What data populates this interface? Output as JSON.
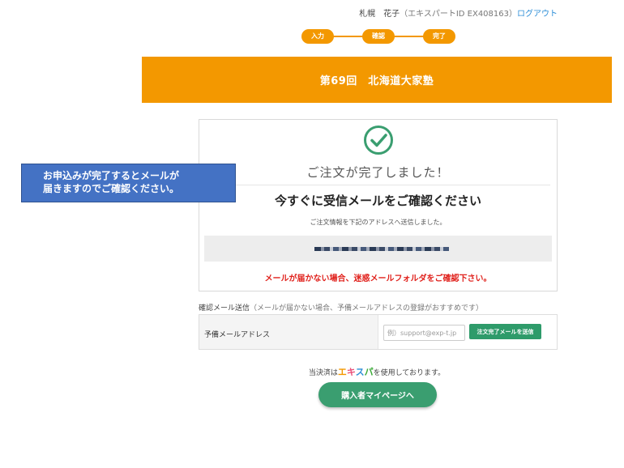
{
  "header": {
    "user_name": "札幌　花子",
    "expert_id": "（エキスパートID EX408163）",
    "logout_label": "ログアウト"
  },
  "steps": [
    {
      "label": "入力"
    },
    {
      "label": "確認"
    },
    {
      "label": "完了"
    }
  ],
  "banner": {
    "title": "第69回　北海道大家塾"
  },
  "completion": {
    "title": "ご注文が完了しました！",
    "mail_check_title": "今すぐに受信メールをご確認ください",
    "sent_text": "ご注文情報を下記のアドレスへ送信しました。",
    "warning_text": "メールが届かない場合、迷惑メールフォルダをご確認下さい。"
  },
  "callout": {
    "line1": "お申込みが完了するとメールが",
    "line2": "届きますのでご確認ください。"
  },
  "confirm_mail": {
    "section_label": "確認メール送信",
    "section_note": "（メールが届かない場合、予備メールアドレスの登録がおすすめです）",
    "row_label": "予備メールアドレス",
    "input_placeholder": "例）support@exp-t.jp",
    "send_button_label": "注文完了メールを送信"
  },
  "payment": {
    "prefix": "当決済は",
    "brand": [
      "エ",
      "キ",
      "ス",
      "パ"
    ],
    "suffix": "を使用しております。"
  },
  "mypage_button_label": "購入者マイページへ",
  "colors": {
    "accent": "#f39800",
    "success": "#3a9e70",
    "warning": "#e0201b",
    "callout": "#4472c4",
    "link": "#2f8fd8"
  }
}
